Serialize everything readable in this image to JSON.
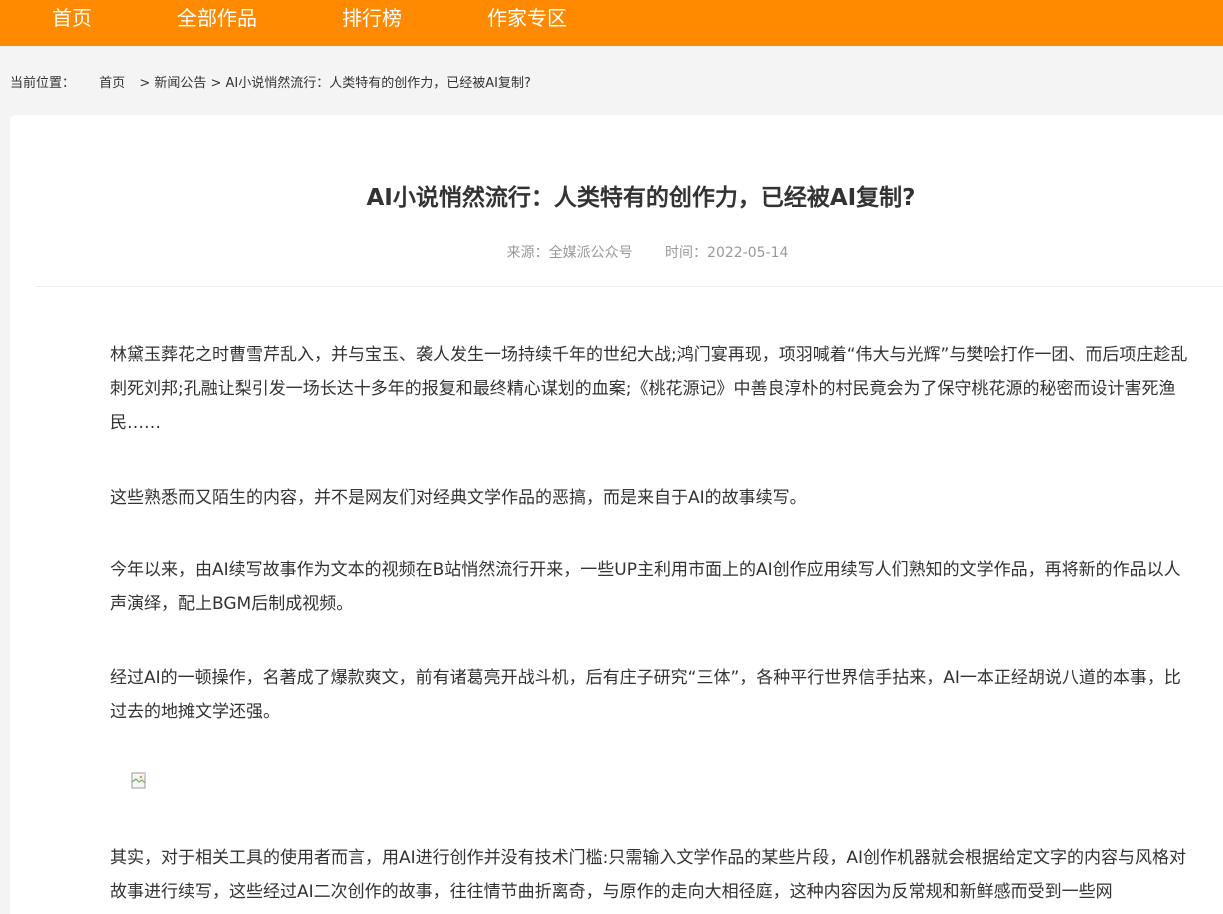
{
  "nav": {
    "items": [
      {
        "label": "首页"
      },
      {
        "label": "全部作品"
      },
      {
        "label": "排行榜"
      },
      {
        "label": "作家专区"
      }
    ],
    "bg_color": "#ff8a00"
  },
  "breadcrumb": {
    "prefix": "当前位置：",
    "home": "首页",
    "section": "> 新闻公告",
    "current": "> AI小说悄然流行：人类特有的创作力，已经被AI复制?"
  },
  "article": {
    "title": "AI小说悄然流行：人类特有的创作力，已经被AI复制?",
    "source": "来源：全媒派公众号",
    "time": "时间：2022-05-14",
    "paragraphs": [
      "林黛玉葬花之时曹雪芹乱入，并与宝玉、袭人发生一场持续千年的世纪大战;鸿门宴再现，项羽喊着“伟大与光辉”与樊哙打作一团、而后项庄趁乱刺死刘邦;孔融让梨引发一场长达十多年的报复和最终精心谋划的血案;《桃花源记》中善良淳朴的村民竟会为了保守桃花源的秘密而设计害死渔民……",
      "这些熟悉而又陌生的内容，并不是网友们对经典文学作品的恶搞，而是来自于AI的故事续写。",
      "今年以来，由AI续写故事作为文本的视频在B站悄然流行开来，一些UP主利用市面上的AI创作应用续写人们熟知的文学作品，再将新的作品以人声演绎，配上BGM后制成视频。",
      "经过AI的一顿操作，名著成了爆款爽文，前有诸葛亮开战斗机，后有庄子研究“三体”，各种平行世界信手拈来，AI一本正经胡说八道的本事，比过去的地摊文学还强。",
      "其实，对于相关工具的使用者而言，用AI进行创作并没有技术门槛:只需输入文学作品的某些片段，AI创作机器就会根据给定文字的内容与风格对故事进行续写，这些经过AI二次创作的故事，往往情节曲折离奇，与原作的走向大相径庭，这种内容因为反常规和新鲜感而受到一些网"
    ],
    "image_icon": "broken-image-icon"
  }
}
